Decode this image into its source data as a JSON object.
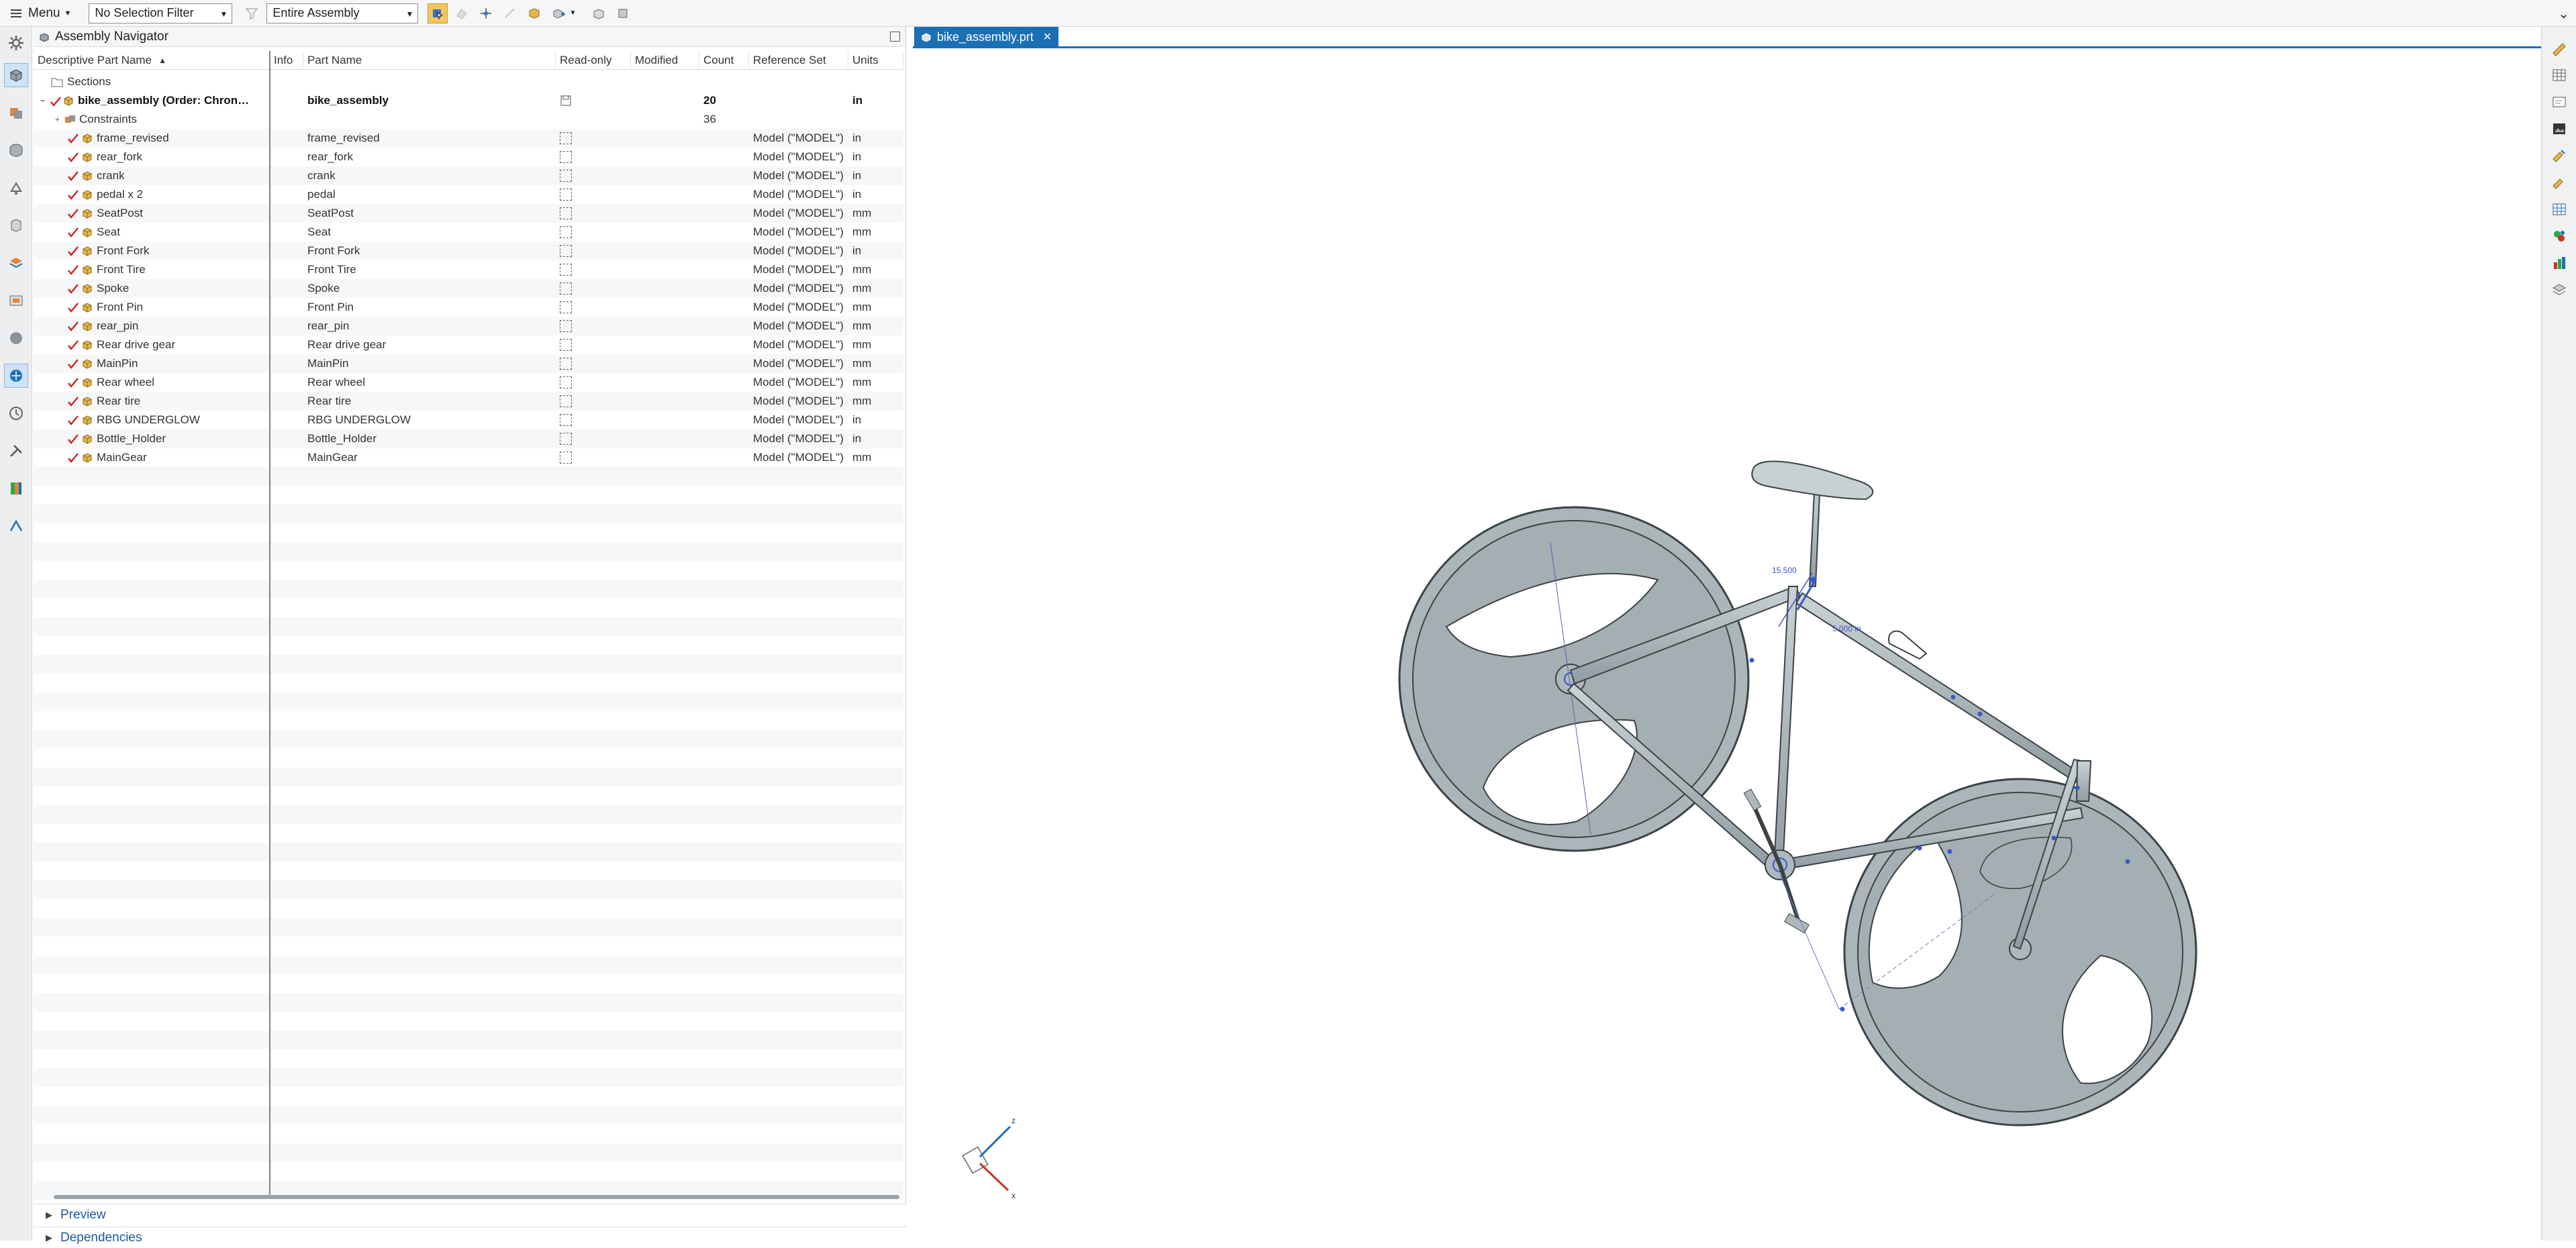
{
  "toolbar": {
    "menu_label": "Menu",
    "selection_filter": "No Selection Filter",
    "scope": "Entire Assembly"
  },
  "navigator": {
    "title": "Assembly Navigator",
    "columns": [
      "Descriptive Part Name",
      "Info",
      "Part Name",
      "Read-only",
      "Modified",
      "Count",
      "Reference Set",
      "Units"
    ],
    "sections_label": "Sections",
    "root": {
      "name": "bike_assembly (Order: Chron…",
      "part": "bike_assembly",
      "count": "20",
      "units": "in"
    },
    "constraints": {
      "name": "Constraints",
      "count": "36"
    },
    "parts": [
      {
        "name": "frame_revised",
        "part": "frame_revised",
        "ref": "Model (\"MODEL\")",
        "units": "in"
      },
      {
        "name": "rear_fork",
        "part": "rear_fork",
        "ref": "Model (\"MODEL\")",
        "units": "in"
      },
      {
        "name": "crank",
        "part": "crank",
        "ref": "Model (\"MODEL\")",
        "units": "in"
      },
      {
        "name": "pedal x 2",
        "part": "pedal",
        "ref": "Model (\"MODEL\")",
        "units": "in"
      },
      {
        "name": "SeatPost",
        "part": "SeatPost",
        "ref": "Model (\"MODEL\")",
        "units": "mm"
      },
      {
        "name": "Seat",
        "part": "Seat",
        "ref": "Model (\"MODEL\")",
        "units": "mm"
      },
      {
        "name": "Front Fork",
        "part": "Front Fork",
        "ref": "Model (\"MODEL\")",
        "units": "in"
      },
      {
        "name": "Front Tire",
        "part": "Front Tire",
        "ref": "Model (\"MODEL\")",
        "units": "mm"
      },
      {
        "name": "Spoke",
        "part": "Spoke",
        "ref": "Model (\"MODEL\")",
        "units": "mm"
      },
      {
        "name": "Front Pin",
        "part": "Front Pin",
        "ref": "Model (\"MODEL\")",
        "units": "mm"
      },
      {
        "name": "rear_pin",
        "part": "rear_pin",
        "ref": "Model (\"MODEL\")",
        "units": "mm"
      },
      {
        "name": "Rear drive gear",
        "part": "Rear drive gear",
        "ref": "Model (\"MODEL\")",
        "units": "mm"
      },
      {
        "name": "MainPin",
        "part": "MainPin",
        "ref": "Model (\"MODEL\")",
        "units": "mm"
      },
      {
        "name": "Rear wheel",
        "part": "Rear wheel",
        "ref": "Model (\"MODEL\")",
        "units": "mm"
      },
      {
        "name": "Rear tire",
        "part": "Rear tire",
        "ref": "Model (\"MODEL\")",
        "units": "mm"
      },
      {
        "name": "RBG UNDERGLOW",
        "part": "RBG UNDERGLOW",
        "ref": "Model (\"MODEL\")",
        "units": "in"
      },
      {
        "name": "Bottle_Holder",
        "part": "Bottle_Holder",
        "ref": "Model (\"MODEL\")",
        "units": "in"
      },
      {
        "name": "MainGear",
        "part": "MainGear",
        "ref": "Model (\"MODEL\")",
        "units": "mm"
      }
    ],
    "preview_label": "Preview",
    "dependencies_label": "Dependencies"
  },
  "graphics": {
    "tab_label": "bike_assembly.prt",
    "dim_label_1": "15.500",
    "dim_label_2": "5.000 in",
    "axis_z": "z",
    "axis_x": "x"
  },
  "colors": {
    "accent": "#1a6fb5",
    "part_body": "#a7b4b8",
    "part_edge": "#3c4245",
    "constraint": "#3a58c8",
    "check_red": "#cc2222"
  }
}
